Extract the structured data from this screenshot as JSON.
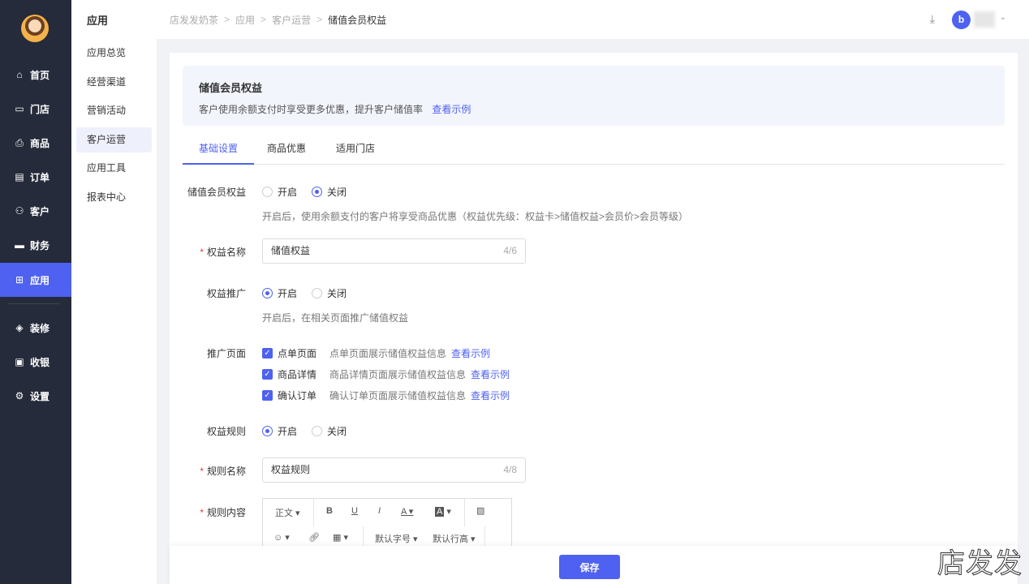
{
  "sidebar": {
    "items": [
      {
        "label": "首页",
        "icon": "⌂"
      },
      {
        "label": "门店",
        "icon": "▭"
      },
      {
        "label": "商品",
        "icon": "⎙"
      },
      {
        "label": "订单",
        "icon": "▤"
      },
      {
        "label": "客户",
        "icon": "⚇"
      },
      {
        "label": "财务",
        "icon": "▬"
      },
      {
        "label": "应用",
        "icon": "⊞"
      },
      {
        "label": "装修",
        "icon": "◈"
      },
      {
        "label": "收银",
        "icon": "▣"
      },
      {
        "label": "设置",
        "icon": "⚙"
      }
    ]
  },
  "submenu": {
    "title": "应用",
    "items": [
      "应用总览",
      "经营渠道",
      "营销活动",
      "客户运营",
      "应用工具",
      "报表中心"
    ]
  },
  "breadcrumb": [
    "店发发奶茶",
    "应用",
    "客户运营",
    "储值会员权益"
  ],
  "header": {
    "logo": "b"
  },
  "banner": {
    "title": "储值会员权益",
    "desc": "客户使用余额支付时享受更多优惠，提升客户储值率",
    "link": "查看示例"
  },
  "tabs": [
    "基础设置",
    "商品优惠",
    "适用门店"
  ],
  "form": {
    "enable": {
      "label": "储值会员权益",
      "on": "开启",
      "off": "关闭",
      "value": "off",
      "hint": "开启后，使用余额支付的客户将享受商品优惠（权益优先级：权益卡>储值权益>会员价>会员等级）"
    },
    "name": {
      "label": "权益名称",
      "value": "储值权益",
      "count": "4/6"
    },
    "promo": {
      "label": "权益推广",
      "on": "开启",
      "off": "关闭",
      "value": "on",
      "hint": "开启后，在相关页面推广储值权益"
    },
    "pages": {
      "label": "推广页面",
      "items": [
        {
          "name": "点单页面",
          "desc": "点单页面展示储值权益信息",
          "link": "查看示例",
          "checked": true
        },
        {
          "name": "商品详情",
          "desc": "商品详情页面展示储值权益信息",
          "link": "查看示例",
          "checked": true
        },
        {
          "name": "确认订单",
          "desc": "确认订单页面展示储值权益信息",
          "link": "查看示例",
          "checked": true
        }
      ]
    },
    "rules": {
      "label": "权益规则",
      "on": "开启",
      "off": "关闭",
      "value": "on"
    },
    "rule_name": {
      "label": "规则名称",
      "value": "权益规则",
      "count": "4/8"
    },
    "rule_content": {
      "label": "规则内容"
    }
  },
  "editor": {
    "style": "正文",
    "bold": "B",
    "underline": "U",
    "italic": "I",
    "color": "A",
    "bg": "A",
    "font_size": "默认字号",
    "line_height": "默认行高"
  },
  "footer": {
    "save": "保存"
  },
  "watermark": "店发发",
  "colors": {
    "accent": "#4e61f0",
    "sidebar": "#252b3a"
  }
}
